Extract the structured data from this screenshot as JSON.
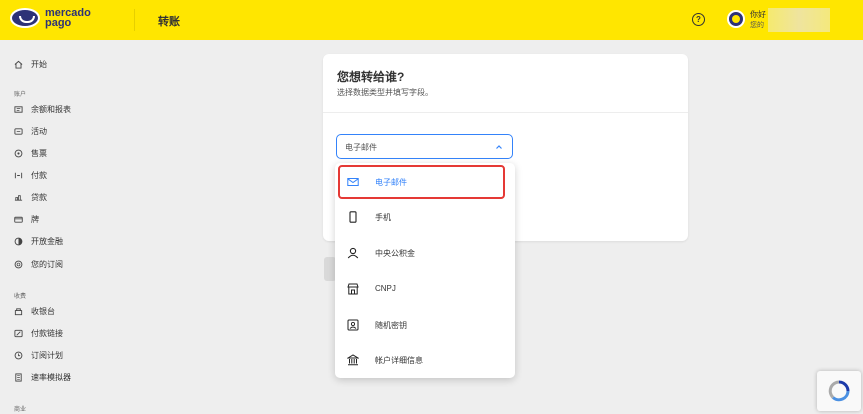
{
  "header": {
    "logo_text": "mercado pago",
    "title": "转账",
    "help_glyph": "?",
    "user_name": "你好",
    "user_sub": "您的"
  },
  "sidebar": {
    "items": [
      {
        "label": "开始",
        "icon": "home-icon"
      },
      {
        "label": "账户",
        "section": true
      },
      {
        "label": "余额和报表",
        "icon": "statement-icon"
      },
      {
        "label": "活动",
        "icon": "activity-icon"
      },
      {
        "label": "售票",
        "icon": "ticket-icon"
      },
      {
        "label": "付款",
        "icon": "payment-icon"
      },
      {
        "label": "贷款",
        "icon": "loan-icon"
      },
      {
        "label": "牌",
        "icon": "card-icon"
      },
      {
        "label": "开放金融",
        "icon": "open-finance-icon"
      },
      {
        "label": "您的订阅",
        "icon": "subscription-icon"
      },
      {
        "label": "收费",
        "section": true
      },
      {
        "label": "收银台",
        "icon": "checkout-icon"
      },
      {
        "label": "付款链接",
        "icon": "link-icon"
      },
      {
        "label": "订阅计划",
        "icon": "plan-icon"
      },
      {
        "label": "速率模拟器",
        "icon": "simulator-icon"
      },
      {
        "label": "商业",
        "section": true
      }
    ]
  },
  "transfer": {
    "title": "您想转给谁?",
    "subtitle": "选择数据类型并填写字段。",
    "select_value": "电子邮件"
  },
  "dropdown": {
    "options": [
      {
        "label": "电子邮件",
        "icon": "email-icon",
        "selected": true
      },
      {
        "label": "手机",
        "icon": "phone-icon"
      },
      {
        "label": "中央公积金",
        "icon": "person-icon"
      },
      {
        "label": "CNPJ",
        "icon": "store-icon"
      },
      {
        "label": "随机密钥",
        "icon": "id-card-icon"
      },
      {
        "label": "帐户详细信息",
        "icon": "bank-icon"
      }
    ]
  },
  "colors": {
    "brand_yellow": "#ffe600",
    "accent_blue": "#3483fa",
    "highlight_red": "#e53935",
    "logo_navy": "#2d3277"
  }
}
